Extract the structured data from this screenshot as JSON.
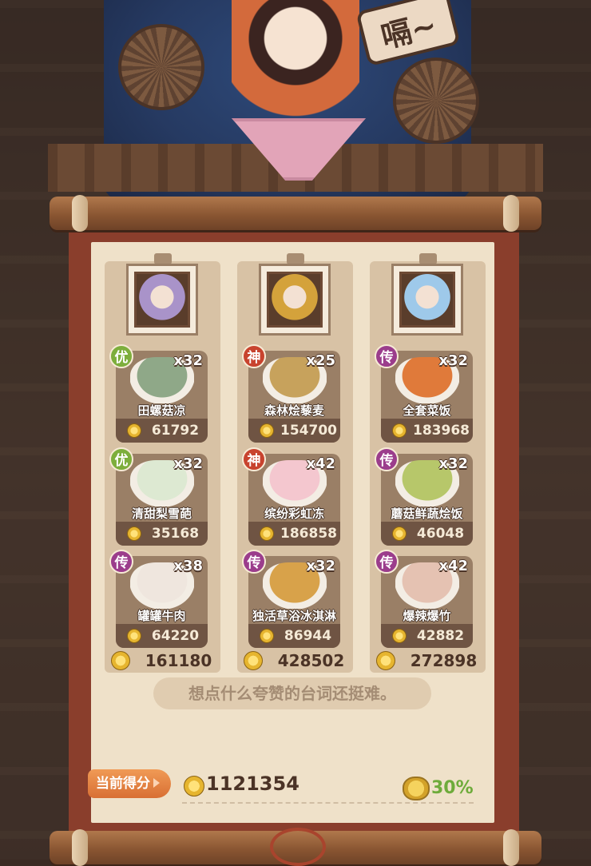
{
  "header": {
    "speech_badge": "嗝~"
  },
  "colors": {
    "rank_you": "#7dae3c",
    "rank_shen": "#c8432e",
    "rank_chuan": "#9b3d8c",
    "dish_panel": "#9a7f66",
    "accent_green": "#6eab3b"
  },
  "columns": [
    {
      "portrait_icon": "purple-haired-character-portrait",
      "total": "161180",
      "dishes": [
        {
          "rank": "优",
          "rank_color": "#7dae3c",
          "name": "田螺菇凉",
          "count": "x32",
          "price": "61792",
          "art_color": "#8fa888"
        },
        {
          "rank": "优",
          "rank_color": "#7dae3c",
          "name": "清甜梨雪葩",
          "count": "x32",
          "price": "35168",
          "art_color": "#dde9d2"
        },
        {
          "rank": "传",
          "rank_color": "#9b3d8c",
          "name": "罐罐牛肉",
          "count": "x38",
          "price": "64220",
          "art_color": "#efe6de"
        }
      ]
    },
    {
      "portrait_icon": "opera-masked-character-portrait",
      "total": "428502",
      "dishes": [
        {
          "rank": "神",
          "rank_color": "#c8432e",
          "name": "森林烩藜麦",
          "count": "x25",
          "price": "154700",
          "art_color": "#c7a25c"
        },
        {
          "rank": "神",
          "rank_color": "#c8432e",
          "name": "缤纷彩虹冻",
          "count": "x42",
          "price": "186858",
          "art_color": "#f4c7cf"
        },
        {
          "rank": "传",
          "rank_color": "#9b3d8c",
          "name": "独活草浴冰淇淋",
          "count": "x32",
          "price": "86944",
          "art_color": "#d8a24a"
        }
      ]
    },
    {
      "portrait_icon": "blue-haired-character-portrait",
      "total": "272898",
      "dishes": [
        {
          "rank": "传",
          "rank_color": "#9b3d8c",
          "name": "全套菜饭",
          "count": "x32",
          "price": "183968",
          "art_color": "#e07a3a"
        },
        {
          "rank": "传",
          "rank_color": "#9b3d8c",
          "name": "蘑菇鲜蔬烩饭",
          "count": "x32",
          "price": "46048",
          "art_color": "#b7c76a"
        },
        {
          "rank": "传",
          "rank_color": "#9b3d8c",
          "name": "爆辣爆竹",
          "count": "x42",
          "price": "42882",
          "art_color": "#e5c2b2"
        }
      ]
    }
  ],
  "quote": "想点什么夸赞的台词还挺难。",
  "score": {
    "label": "当前得分",
    "value": "1121354",
    "bonus": "30%"
  }
}
